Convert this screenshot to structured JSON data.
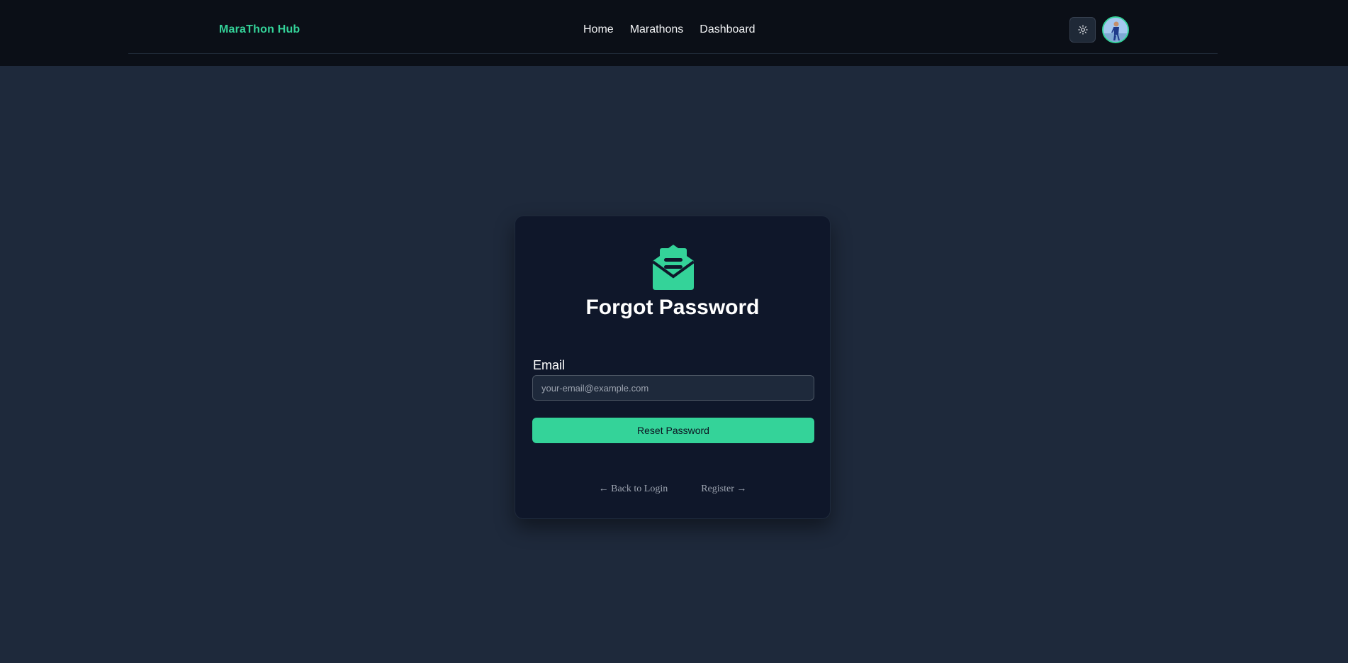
{
  "header": {
    "brand": "MaraThon Hub",
    "nav": [
      "Home",
      "Marathons",
      "Dashboard"
    ],
    "theme_toggle_icon": "sun-icon",
    "avatar_icon": "user-avatar"
  },
  "card": {
    "icon": "envelope-open-icon",
    "title": "Forgot Password",
    "email_label": "Email",
    "email_placeholder": "your-email@example.com",
    "email_value": "",
    "reset_button": "Reset Password",
    "back_link": "← Back to Login",
    "register_link": "Register →"
  },
  "colors": {
    "accent": "#34d399",
    "page_bg": "#1e293b",
    "card_bg": "#0f172a",
    "header_bg": "#0b0f17"
  }
}
